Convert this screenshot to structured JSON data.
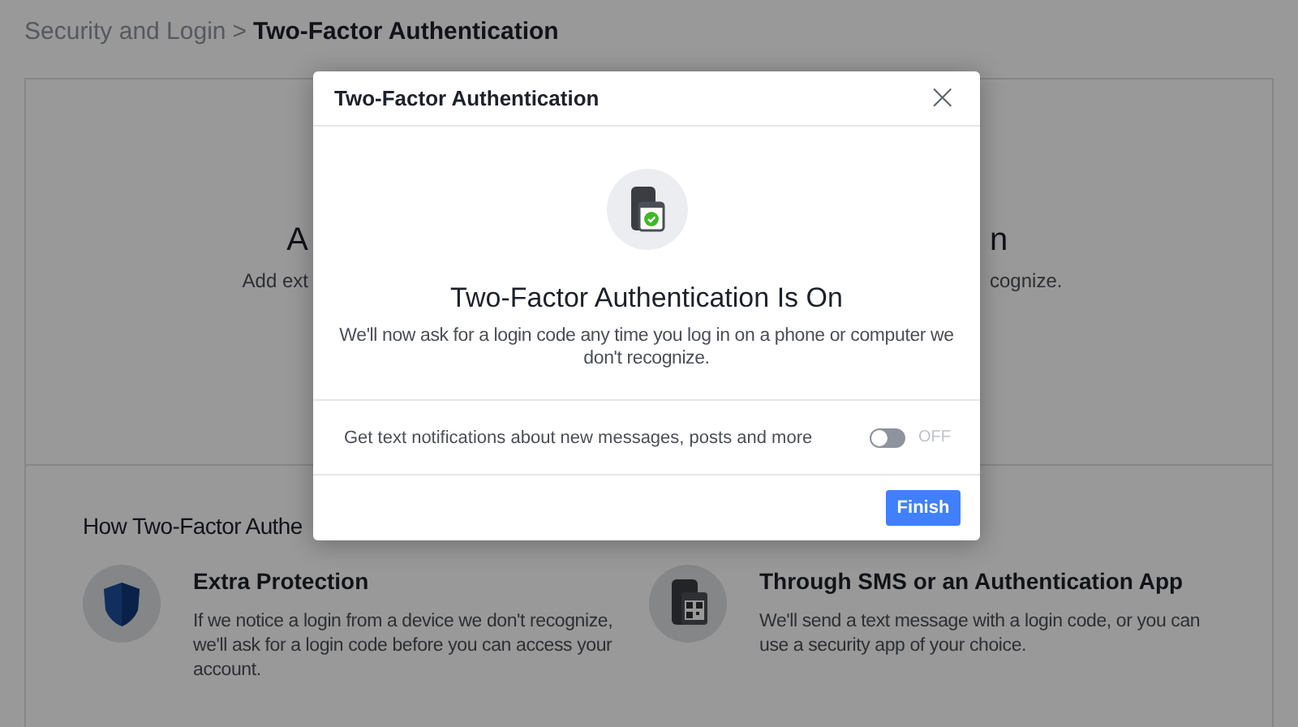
{
  "breadcrumb": {
    "parent": "Security and Login",
    "separator": ">",
    "current": "Two-Factor Authentication"
  },
  "hero": {
    "title_left": "A",
    "title_right": "n",
    "subtitle_left": "Add ext",
    "subtitle_right": "cognize."
  },
  "how_section": {
    "title": "How Two-Factor Authe",
    "features": [
      {
        "kind": "shield",
        "title": "Extra Protection",
        "text": "If we notice a login from a device we don't recognize, we'll ask for a login code before you can access your account."
      },
      {
        "kind": "phone",
        "title": "Through SMS or an Authentication App",
        "text": "We'll send a text message with a login code, or you can use a security app of your choice."
      }
    ]
  },
  "dialog": {
    "title": "Two-Factor Authentication",
    "close": "×",
    "heading": "Two-Factor Authentication Is On",
    "message": "We'll now ask for a login code any time you log in on a phone or computer we don't recognize.",
    "notification": {
      "label": "Get text notifications about new messages, posts and more",
      "on": false,
      "state_label": "OFF"
    },
    "button": "Finish"
  }
}
